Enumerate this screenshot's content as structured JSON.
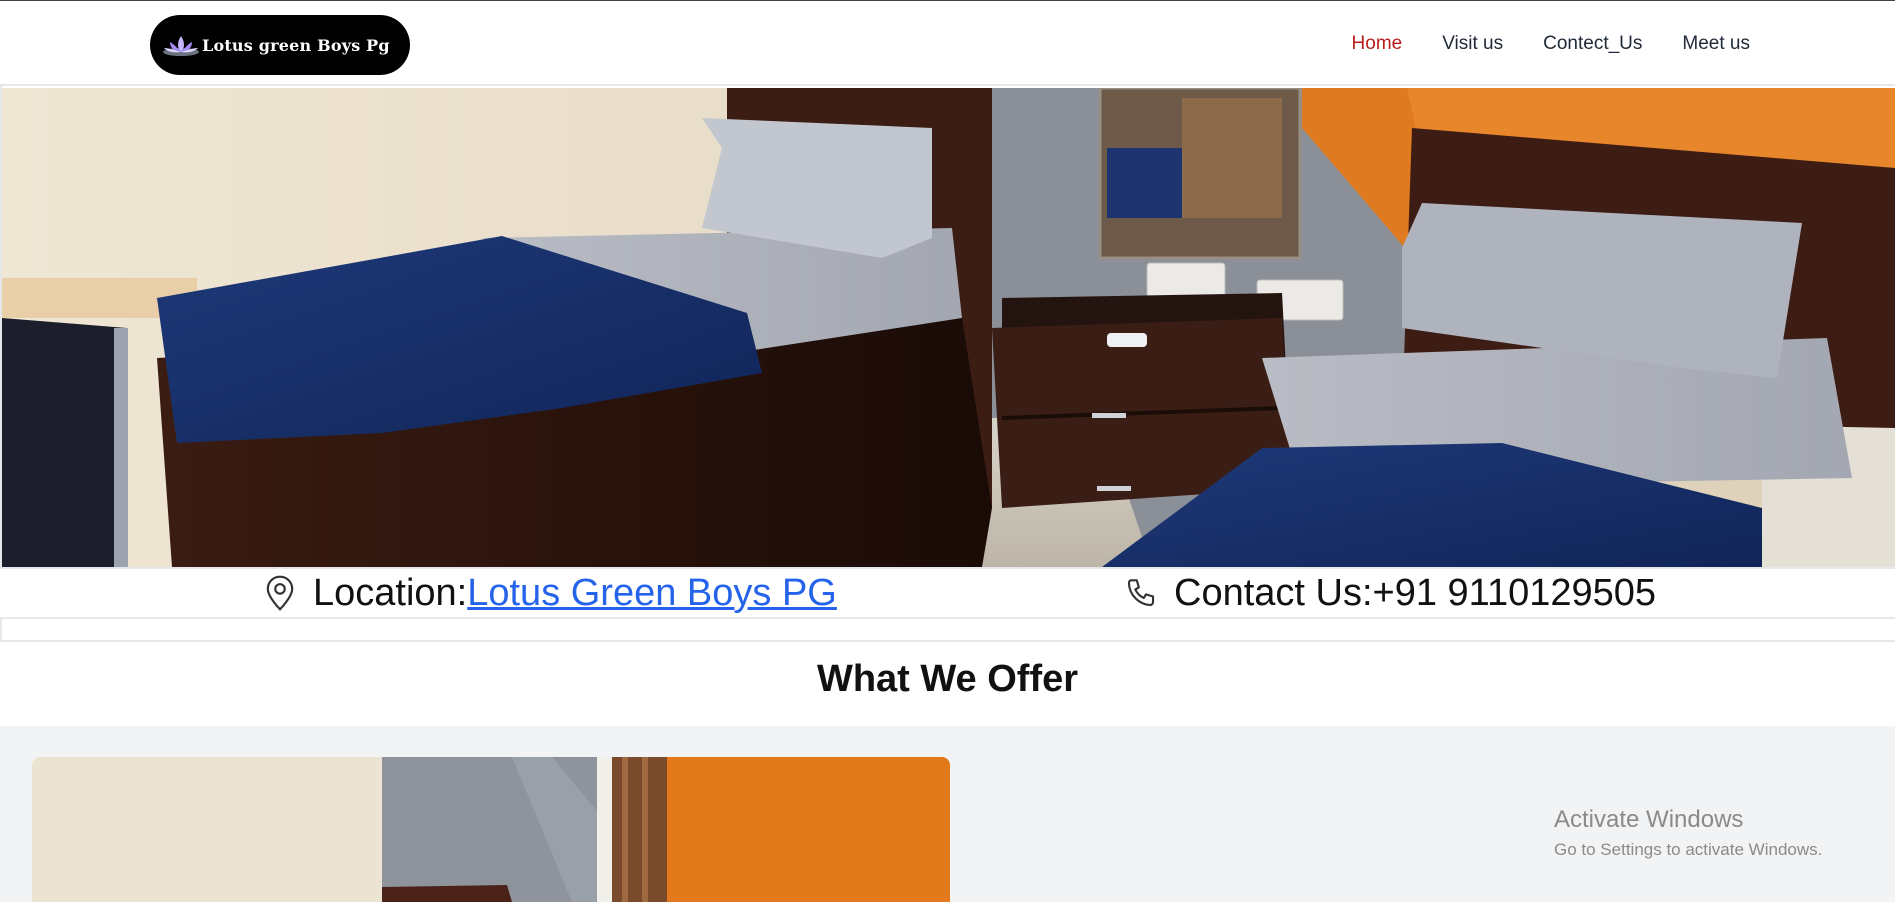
{
  "header": {
    "logo_text": "Lotus green Boys Pg",
    "nav": [
      {
        "label": "Home",
        "active": true
      },
      {
        "label": "Visit us",
        "active": false
      },
      {
        "label": "Contect_Us",
        "active": false
      },
      {
        "label": "Meet us",
        "active": false
      }
    ]
  },
  "hero": {
    "icon": "bedroom-photo"
  },
  "info": {
    "location_label": "Location: ",
    "location_link": "Lotus Green Boys PG",
    "contact_text": "Contact Us:+91 9110129505",
    "location_icon": "map-pin-icon",
    "contact_icon": "phone-icon"
  },
  "offer": {
    "title": "What We Offer"
  },
  "watermark": {
    "title": "Activate Windows",
    "subtitle": "Go to Settings to activate Windows."
  },
  "colors": {
    "active_nav": "#b91c1c",
    "link": "#2563eb"
  }
}
